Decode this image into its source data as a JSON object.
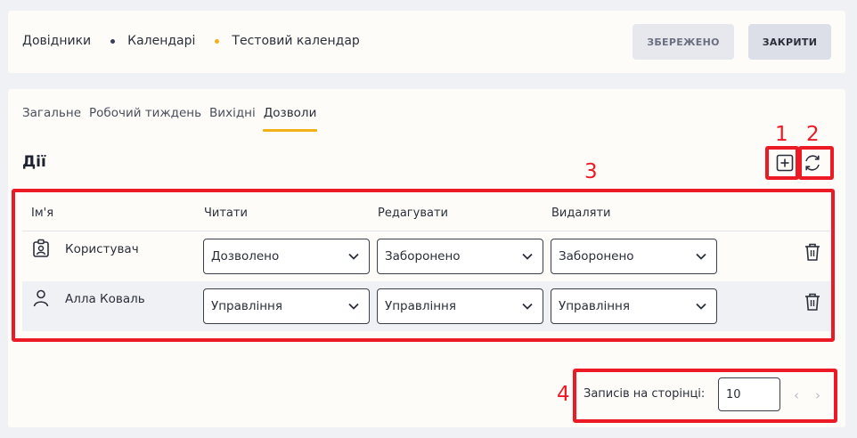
{
  "breadcrumb": [
    "Довідники",
    "Календарі",
    "Тестовий календар"
  ],
  "header": {
    "save_label": "ЗБЕРЕЖЕНО",
    "close_label": "ЗАКРИТИ"
  },
  "tabs": [
    "Загальне",
    "Робочий тиждень",
    "Вихідні",
    "Дозволи"
  ],
  "active_tab": "Дозволи",
  "section": {
    "title": "Дії"
  },
  "table": {
    "columns": [
      "Ім'я",
      "Читати",
      "Редагувати",
      "Видаляти"
    ],
    "rows": [
      {
        "icon": "role-badge-icon",
        "name": "Користувач",
        "read": "Дозволено",
        "edit": "Заборонено",
        "delete": "Заборонено"
      },
      {
        "icon": "person-icon",
        "name": "Алла Коваль",
        "read": "Управління",
        "edit": "Управління",
        "delete": "Управління"
      }
    ]
  },
  "pagination": {
    "label": "Записів на сторінці:",
    "page_size": "10"
  },
  "annotations": [
    "1",
    "2",
    "3",
    "4"
  ],
  "colors": {
    "accent": "#f2b01b",
    "annotation": "#ec1a24"
  }
}
